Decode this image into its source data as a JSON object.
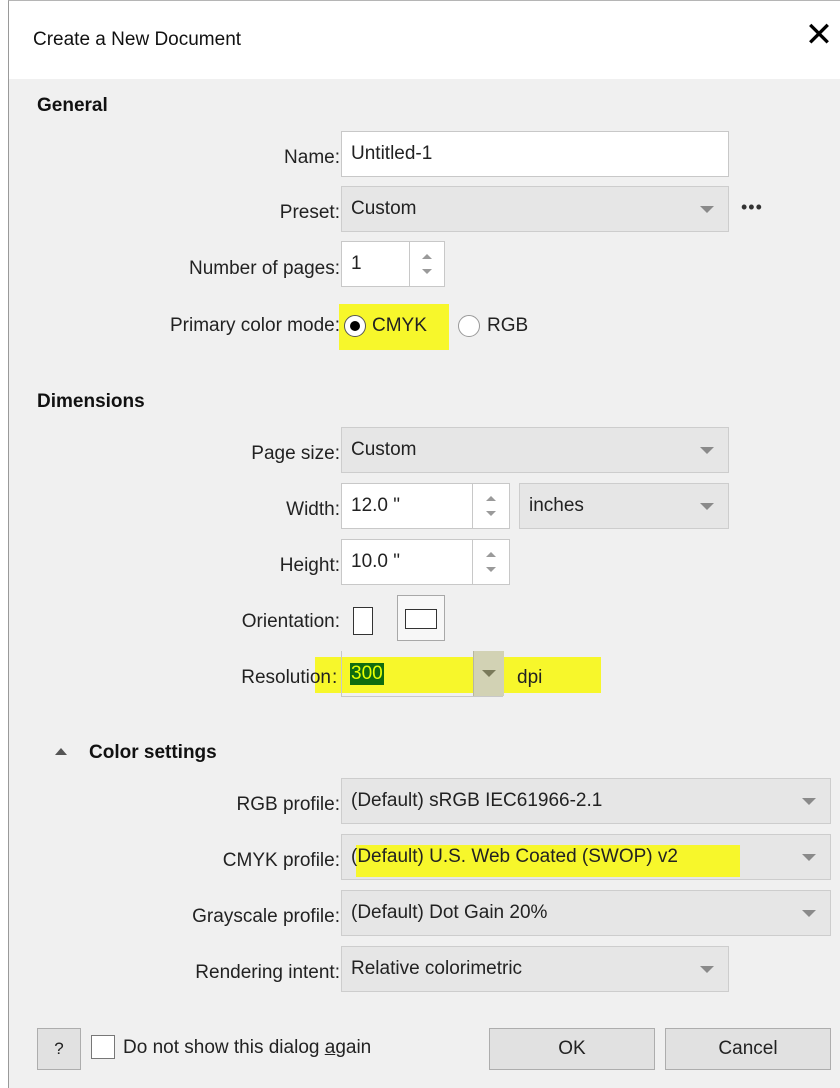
{
  "dialog": {
    "title": "Create a New Document"
  },
  "general": {
    "heading": "General",
    "name_label": "Name:",
    "name_value": "Untitled-1",
    "preset_label": "Preset:",
    "preset_value": "Custom",
    "preset_more": "•••",
    "pages_label": "Number of pages:",
    "pages_value": "1",
    "color_mode_label": "Primary color mode:",
    "color_mode_options": [
      "CMYK",
      "RGB"
    ],
    "color_mode_selected": "CMYK"
  },
  "dimensions": {
    "heading": "Dimensions",
    "page_size_label": "Page size:",
    "page_size_value": "Custom",
    "width_label": "Width:",
    "width_value": "12.0 \"",
    "units_value": "inches",
    "height_label": "Height:",
    "height_value": "10.0 \"",
    "orientation_label": "Orientation:",
    "resolution_label_main": "Resolution",
    "resolution_label_colon": ":",
    "resolution_value": "300",
    "resolution_unit": "dpi"
  },
  "color_settings": {
    "heading": "Color settings",
    "rgb_label": "RGB profile:",
    "rgb_value": "(Default) sRGB IEC61966-2.1",
    "cmyk_label": "CMYK profile:",
    "cmyk_value": "(Default) U.S. Web Coated (SWOP) v2",
    "gray_label": "Grayscale profile:",
    "gray_value": "(Default) Dot Gain 20%",
    "intent_label": "Rendering intent:",
    "intent_value": "Relative colorimetric"
  },
  "footer": {
    "help_label": "?",
    "dont_show_prefix": "Do not show this dialog ",
    "dont_show_accel": "a",
    "dont_show_suffix": "gain",
    "dont_show_checked": false,
    "ok_label": "OK",
    "cancel_label": "Cancel"
  },
  "colors": {
    "highlight": "#f7f72b",
    "selected_text_bg": "#0f6b0f",
    "dialog_bg": "#f0f0f0"
  }
}
